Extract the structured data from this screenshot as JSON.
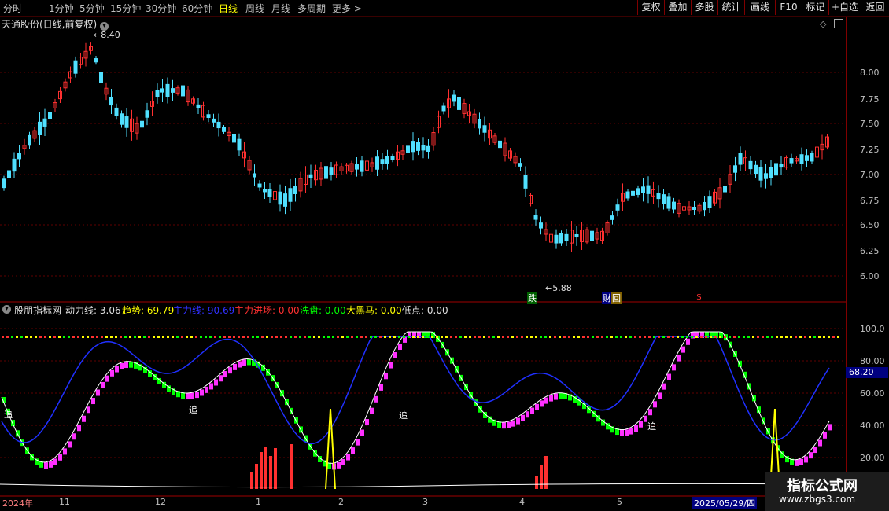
{
  "toolbar": {
    "timeframes": [
      "分时",
      "1分钟",
      "5分钟",
      "15分钟",
      "30分钟",
      "60分钟",
      "日线",
      "周线",
      "月线",
      "多周期",
      "更多 >"
    ],
    "active_timeframe": "日线",
    "buttons": [
      "复权",
      "叠加",
      "多股",
      "统计",
      "画线",
      "F10",
      "标记",
      "+自选",
      "返回"
    ]
  },
  "main_chart": {
    "title": "天通股份(日线,前复权)",
    "high_label": "8.40",
    "low_label": "5.88",
    "y_ticks": [
      "8.00",
      "7.75",
      "7.50",
      "7.25",
      "7.00",
      "6.75",
      "6.50",
      "6.25",
      "6.00"
    ],
    "markers": {
      "die": "跌",
      "cai": "财",
      "hui": "回",
      "s": "$"
    }
  },
  "indicator": {
    "name": "股朋指标网",
    "items": [
      {
        "label": "动力线:",
        "value": "3.06",
        "color": "#e0e0e0"
      },
      {
        "label": "趋势:",
        "value": "69.79",
        "color": "#ffff00"
      },
      {
        "label": "主力线:",
        "value": "90.69",
        "color": "#3030ff"
      },
      {
        "label": "主力进场:",
        "value": "0.00",
        "color": "#ff3030"
      },
      {
        "label": "洗盘:",
        "value": "0.00",
        "color": "#00ff00"
      },
      {
        "label": "大黑马:",
        "value": "0.00",
        "color": "#ffff00"
      },
      {
        "label": "低点:",
        "value": "0.00",
        "color": "#e0e0e0"
      }
    ],
    "y_ticks": [
      "100.0",
      "80.00",
      "60.00",
      "40.00",
      "20.00"
    ],
    "current_value": "68.20",
    "chase_label": "追"
  },
  "dates": {
    "year": "2024年",
    "months": [
      "11",
      "12",
      "1",
      "2",
      "3",
      "4",
      "5"
    ],
    "cursor_date": "2025/05/29/四"
  },
  "watermark": {
    "title": "指标公式网",
    "url": "www.zbgs3.com"
  },
  "colors": {
    "up": "#ff3030",
    "down": "#50e0ff",
    "green": "#00ff00",
    "magenta": "#ff30ff",
    "blue": "#2030ff",
    "yellow": "#ffff00"
  }
}
